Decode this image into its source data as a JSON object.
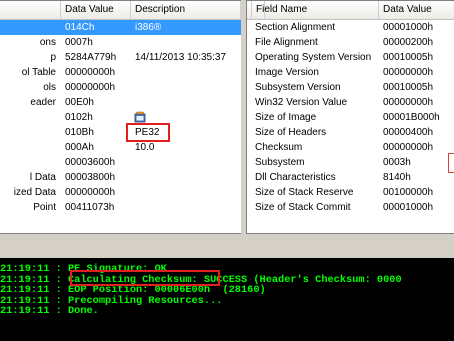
{
  "left_table": {
    "headers": [
      "",
      "Data Value",
      "Description"
    ],
    "rows": [
      {
        "field": "",
        "value": "014Ch",
        "desc": "i386®"
      },
      {
        "field": "ons",
        "value": "0007h",
        "desc": ""
      },
      {
        "field": "p",
        "value": "5284A779h",
        "desc": "14/11/2013  10:35:37"
      },
      {
        "field": "ol Table",
        "value": "00000000h",
        "desc": ""
      },
      {
        "field": "ols",
        "value": "00000000h",
        "desc": ""
      },
      {
        "field": "eader",
        "value": "00E0h",
        "desc": ""
      },
      {
        "field": "",
        "value": "0102h",
        "desc": ""
      },
      {
        "field": "",
        "value": "010Bh",
        "desc": "PE32"
      },
      {
        "field": "",
        "value": "000Ah",
        "desc": "10.0"
      },
      {
        "field": "",
        "value": "00003600h",
        "desc": ""
      },
      {
        "field": "l Data",
        "value": "00003800h",
        "desc": ""
      },
      {
        "field": "ized Data",
        "value": "00000000h",
        "desc": ""
      },
      {
        "field": "Point",
        "value": "00411073h",
        "desc": ""
      }
    ]
  },
  "right_table": {
    "headers": [
      "Field Name",
      "Data Value"
    ],
    "rows": [
      {
        "field": "Section Alignment",
        "value": "00001000h"
      },
      {
        "field": "File Alignment",
        "value": "00000200h"
      },
      {
        "field": "Operating System Version",
        "value": "00010005h"
      },
      {
        "field": "Image Version",
        "value": "00000000h"
      },
      {
        "field": "Subsystem Version",
        "value": "00010005h"
      },
      {
        "field": "Win32 Version Value",
        "value": "00000000h"
      },
      {
        "field": "Size of Image",
        "value": "00001B000h"
      },
      {
        "field": "Size of Headers",
        "value": "00000400h"
      },
      {
        "field": "Checksum",
        "value": "00000000h"
      },
      {
        "field": "Subsystem",
        "value": "0003h"
      },
      {
        "field": "Dll Characteristics",
        "value": "8140h"
      },
      {
        "field": "Size of Stack Reserve",
        "value": "00100000h"
      },
      {
        "field": "Size of Stack Commit",
        "value": "00001000h"
      }
    ]
  },
  "console": {
    "lines": [
      "21:19:11 : PE Signature: OK",
      "21:19:11 : Calculating Checksum: SUCCESS (Header's Checksum: 0000",
      "21:19:11 : EOP Position: 00006E00h  (28160)",
      "21:19:11 : Precompiling Resources...",
      "21:19:11 : Done."
    ]
  },
  "colors": {
    "selection": "#3399ff",
    "highlight_box": "#e02020",
    "console_text": "#00ff00",
    "console_bg": "#000000"
  },
  "icons": [
    "app-icon"
  ]
}
